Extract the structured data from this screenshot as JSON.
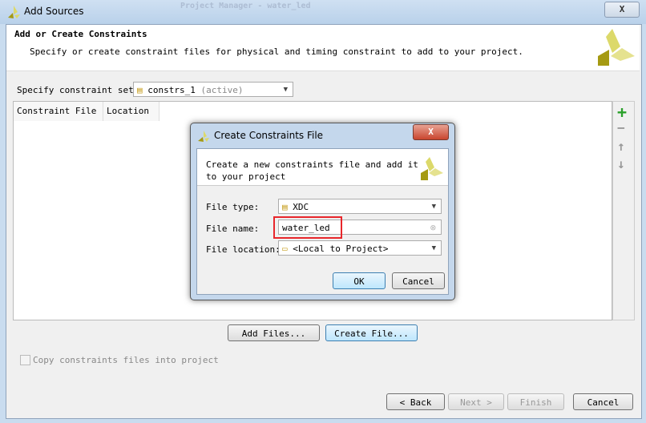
{
  "window": {
    "title": "Add Sources",
    "background_title": "Project Manager - water_led",
    "close": "X"
  },
  "header": {
    "title": "Add or Create Constraints",
    "subtitle": "Specify or create constraint files for physical and timing constraint to add to your project."
  },
  "constraint_set": {
    "label": "Specify constraint set:",
    "value": "constrs_1",
    "suffix": "(active)"
  },
  "table": {
    "columns": [
      "Constraint File",
      "Location"
    ],
    "rows": []
  },
  "side_buttons": [
    "+",
    "−",
    "↑",
    "↓"
  ],
  "buttons": {
    "add_files": "Add Files...",
    "create_file": "Create File...",
    "back": "< Back",
    "next": "Next >",
    "finish": "Finish",
    "cancel": "Cancel"
  },
  "copy_checkbox": {
    "label": "Copy constraints files into project",
    "checked": false,
    "enabled": false
  },
  "dialog": {
    "title": "Create Constraints File",
    "close": "X",
    "description_line1": "Create a new constraints file and add it",
    "description_line2": "to your project",
    "file_type_label": "File type:",
    "file_type": "XDC",
    "file_name_label": "File name:",
    "file_name": "water_led",
    "file_location_label": "File location:",
    "file_location": "<Local to Project>",
    "ok": "OK",
    "cancel": "Cancel"
  },
  "colors": {
    "highlight": "#e8262b",
    "logo_dark": "#a59a12",
    "logo_light": "#dcd96a",
    "add_green": "#2aa02a"
  }
}
